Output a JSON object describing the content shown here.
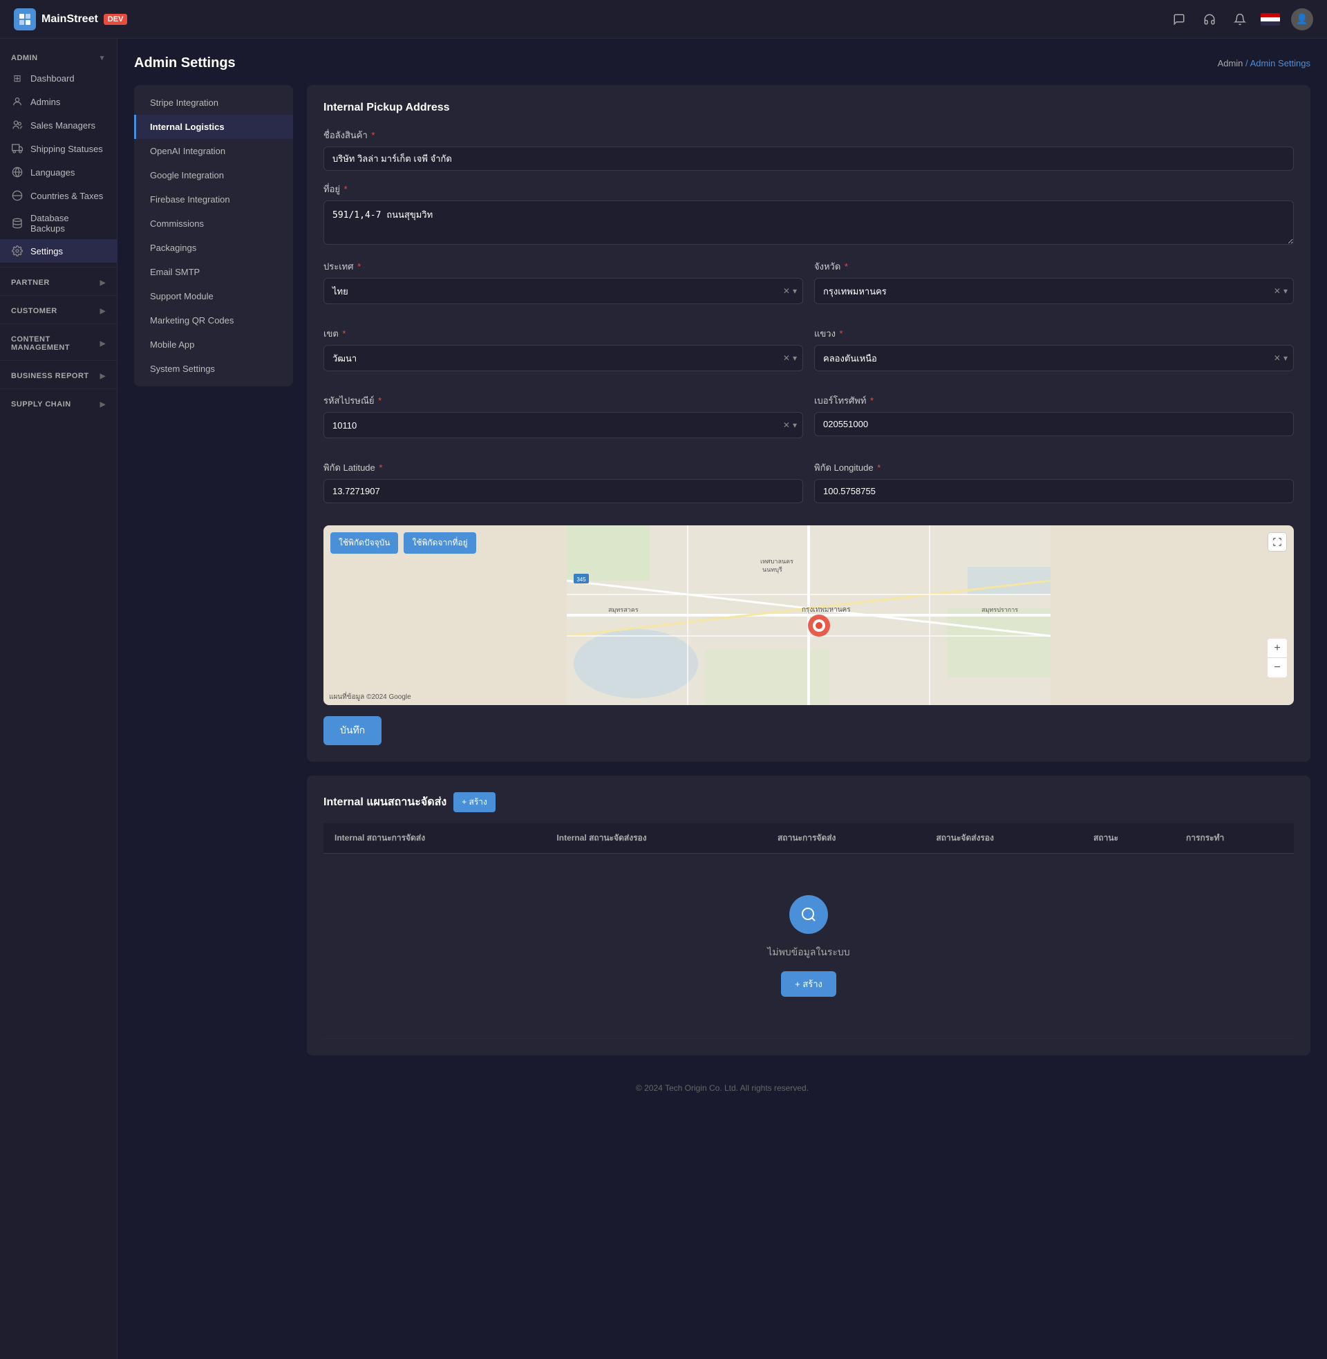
{
  "app": {
    "logo": "M",
    "name": "MainStreet",
    "env_badge": "DEV"
  },
  "breadcrumb": {
    "parent": "Admin",
    "current": "Admin Settings"
  },
  "page_title": "Admin Settings",
  "sidebar": {
    "admin_section": "ADMIN",
    "items": [
      {
        "id": "dashboard",
        "label": "Dashboard",
        "icon": "⊞"
      },
      {
        "id": "admins",
        "label": "Admins",
        "icon": "👤"
      },
      {
        "id": "sales-managers",
        "label": "Sales Managers",
        "icon": "👥"
      },
      {
        "id": "shipping-statuses",
        "label": "Shipping Statuses",
        "icon": "🚚"
      },
      {
        "id": "languages",
        "label": "Languages",
        "icon": "🌐"
      },
      {
        "id": "countries-taxes",
        "label": "Countries & Taxes",
        "icon": "🌍"
      },
      {
        "id": "database-backups",
        "label": "Database Backups",
        "icon": "💾"
      },
      {
        "id": "settings",
        "label": "Settings",
        "icon": "⚙",
        "active": true
      }
    ],
    "partner_section": "PARTNER",
    "customer_section": "CUSTOMER",
    "content_section": "CONTENT MANAGEMENT",
    "business_section": "BUSINESS REPORT",
    "supply_section": "SUPPLY CHAIN"
  },
  "settings_nav": {
    "items": [
      {
        "id": "stripe",
        "label": "Stripe Integration"
      },
      {
        "id": "internal-logistics",
        "label": "Internal Logistics",
        "active": true
      },
      {
        "id": "openai",
        "label": "OpenAI Integration"
      },
      {
        "id": "google",
        "label": "Google Integration"
      },
      {
        "id": "firebase",
        "label": "Firebase Integration"
      },
      {
        "id": "commissions",
        "label": "Commissions"
      },
      {
        "id": "packagings",
        "label": "Packagings"
      },
      {
        "id": "email-smtp",
        "label": "Email SMTP"
      },
      {
        "id": "support-module",
        "label": "Support Module"
      },
      {
        "id": "marketing-qr",
        "label": "Marketing QR Codes"
      },
      {
        "id": "mobile-app",
        "label": "Mobile App"
      },
      {
        "id": "system-settings",
        "label": "System Settings"
      }
    ]
  },
  "internal_pickup": {
    "section_title": "Internal Pickup Address",
    "fields": {
      "company_name_label": "ชื่อลังสินค้า",
      "company_name_value": "บริษัท วิลล่า มาร์เก็ต เจพี จำกัด",
      "address_label": "ที่อยู่",
      "address_value": "591/1,4-7 ถนนสุขุมวิท",
      "country_label": "ประเทศ",
      "country_value": "ไทย",
      "province_label": "จังหวัด",
      "province_value": "กรุงเทพมหานคร",
      "district_label": "เขต",
      "district_value": "วัฒนา",
      "subdistrict_label": "แขวง",
      "subdistrict_value": "คลองตันเหนือ",
      "postal_label": "รหัสไปรษณีย์",
      "postal_value": "10110",
      "phone_label": "เบอร์โทรศัพท์",
      "phone_value": "020551000",
      "latitude_label": "พิกัด Latitude",
      "latitude_value": "13.7271907",
      "longitude_label": "พิกัด Longitude",
      "longitude_value": "100.5758755"
    },
    "map_buttons": {
      "use_current": "ใช้พิกัดปัจจุบัน",
      "use_address": "ใช้พิกัดจากที่อยู่"
    },
    "save_button": "บันทึก",
    "map_credit": "แผนที่ข้อมูล ©2024 Google"
  },
  "internal_map": {
    "section_title": "Internal แผนสถานะจัดส่ง",
    "create_button": "+ สร้าง",
    "table_headers": [
      "Internal สถานะการจัดส่ง",
      "Internal สถานะจัดส่งรอง",
      "สถานะการจัดส่ง",
      "สถานะจัดส่งรอง",
      "สถานะ",
      "การกระทำ"
    ],
    "empty_state": {
      "message": "ไม่พบข้อมูลในระบบ",
      "create_button": "+ สร้าง"
    }
  },
  "footer": {
    "text": "© 2024 Tech Origin Co. Ltd. All rights reserved."
  }
}
